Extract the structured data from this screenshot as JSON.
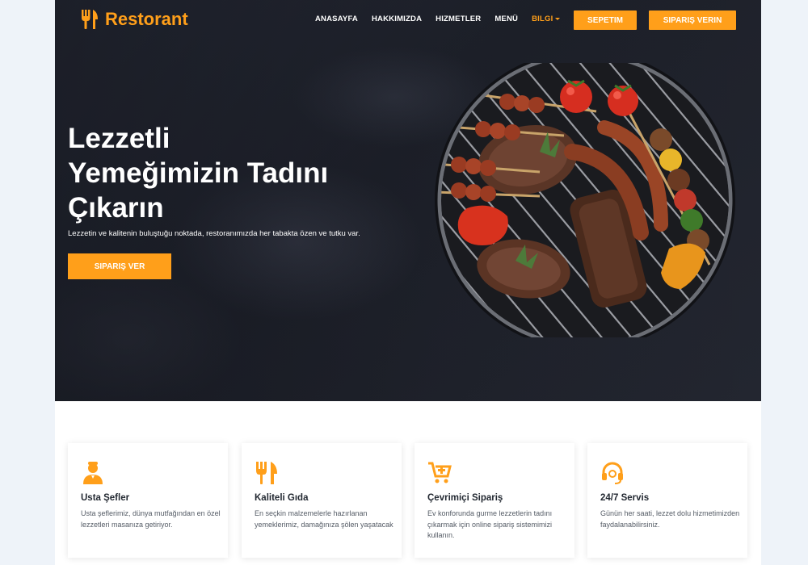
{
  "brand": {
    "name": "Restorant",
    "icon": "fork-knife-icon",
    "accent": "#ff9f1a"
  },
  "nav": {
    "links": [
      {
        "label": "ANASAYFA"
      },
      {
        "label": "HAKKIMIZDA"
      },
      {
        "label": "HIZMETLER"
      },
      {
        "label": "MENÜ"
      },
      {
        "label": "BILGI"
      }
    ],
    "cart_label": "SEPETIM",
    "order_label": "SIPARIŞ VERIN"
  },
  "hero": {
    "title": "Lezzetli\nYemeğimizin Tadını\nÇıkarın",
    "subtitle": "Lezzetin ve kalitenin buluştuğu noktada, restoranımızda her tabakta özen ve tutku var.",
    "button_label": "SIPARIŞ VER"
  },
  "features": [
    {
      "icon": "chef-icon",
      "title": "Usta Şefler",
      "text": "Usta şeflerimiz, dünya mutfağından en özel lezzetleri masanıza getiriyor."
    },
    {
      "icon": "fork-knife-icon",
      "title": "Kaliteli Gıda",
      "text": "En seçkin malzemelerle hazırlanan yemeklerimiz, damağınıza şölen yaşatacak"
    },
    {
      "icon": "cart-plus-icon",
      "title": "Çevrimiçi Sipariş",
      "text": "Ev konforunda gurme lezzetlerin tadını çıkarmak için online sipariş sistemimizi kullanın."
    },
    {
      "icon": "headset-icon",
      "title": "24/7 Servis",
      "text": "Günün her saati, lezzet dolu hizmetimizden faydalanabilirsiniz."
    }
  ]
}
